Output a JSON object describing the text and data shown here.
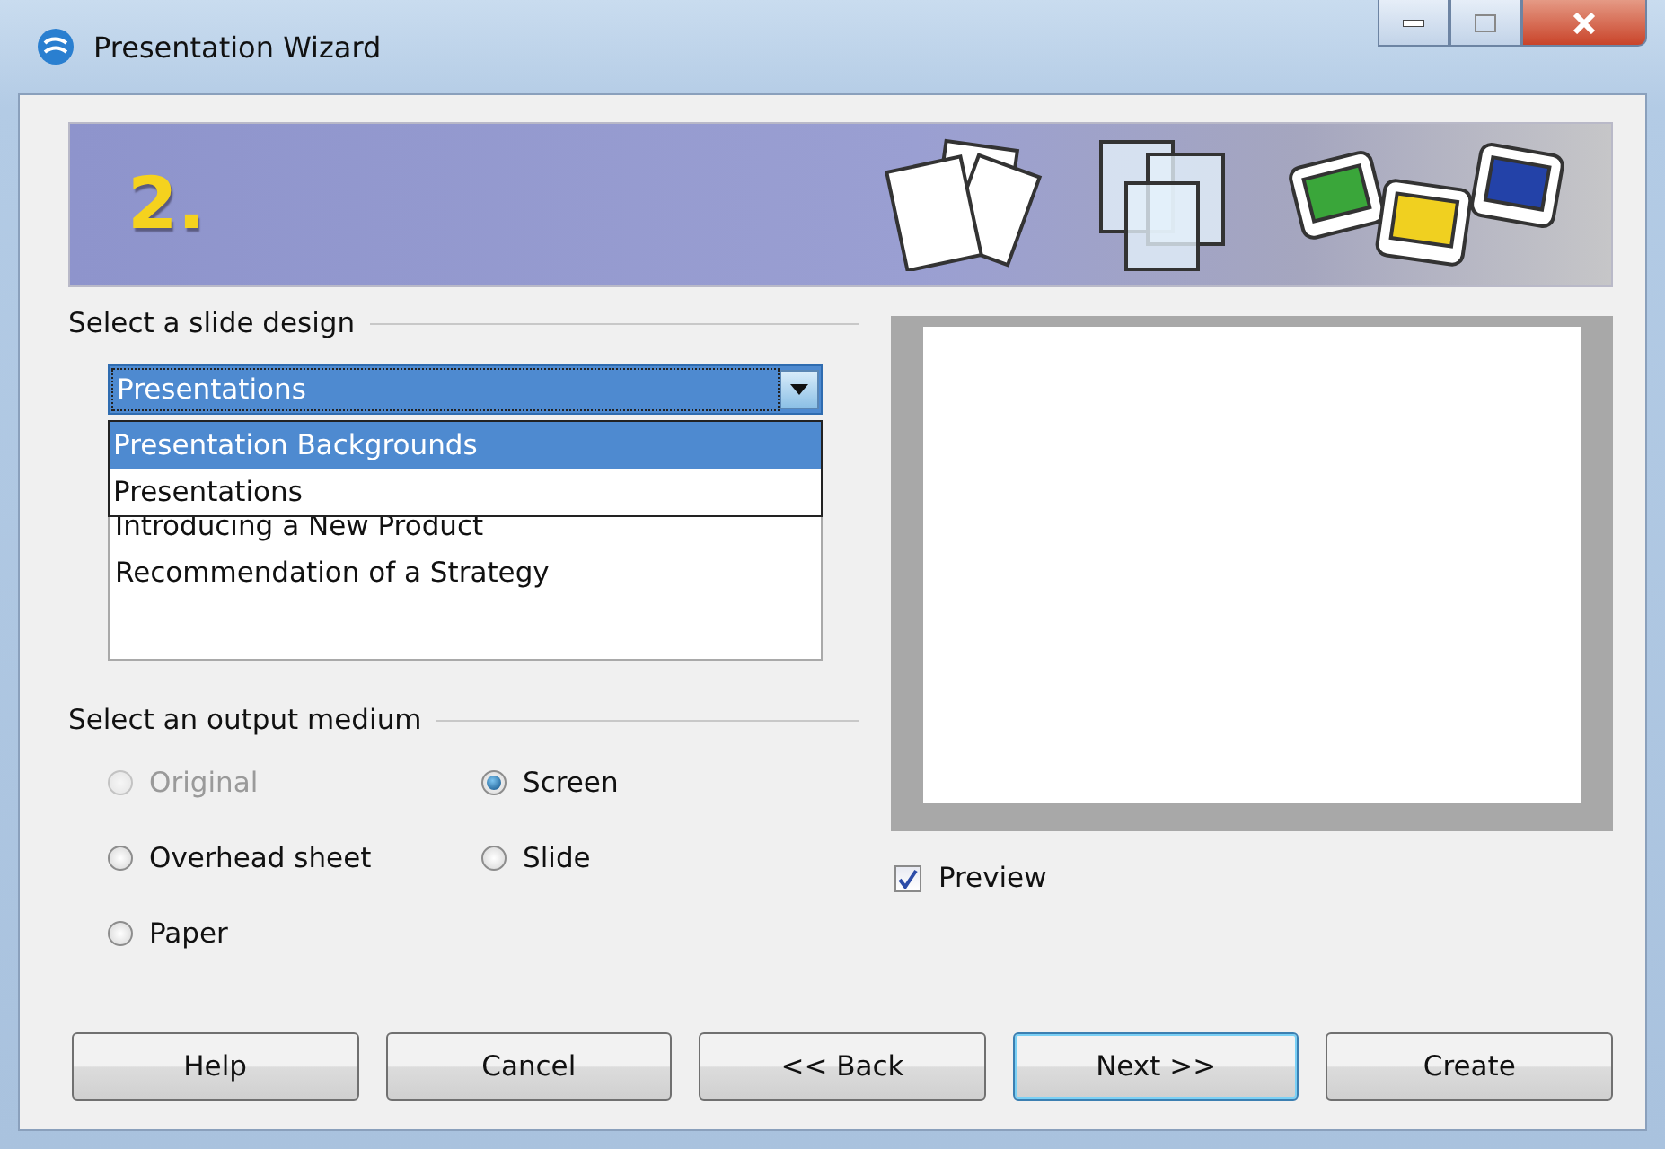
{
  "window": {
    "title": "Presentation Wizard"
  },
  "banner": {
    "step": "2."
  },
  "slide_design": {
    "label": "Select a slide design",
    "category": {
      "value": "Presentations",
      "expanded": true,
      "options": [
        {
          "label": "Presentation Backgrounds",
          "highlighted": true
        },
        {
          "label": "Presentations",
          "highlighted": false
        }
      ]
    },
    "designs": [
      "Introducing a New Product",
      "Recommendation of a Strategy"
    ]
  },
  "output_medium": {
    "label": "Select an output medium",
    "options": [
      {
        "label": "Original",
        "selected": false,
        "disabled": true
      },
      {
        "label": "Screen",
        "selected": true,
        "disabled": false
      },
      {
        "label": "Overhead sheet",
        "selected": false,
        "disabled": false
      },
      {
        "label": "Slide",
        "selected": false,
        "disabled": false
      },
      {
        "label": "Paper",
        "selected": false,
        "disabled": false
      }
    ]
  },
  "preview": {
    "label": "Preview",
    "checked": true
  },
  "buttons": [
    {
      "label": "Help",
      "focused": false
    },
    {
      "label": "Cancel",
      "focused": false
    },
    {
      "label": "<< Back",
      "focused": false
    },
    {
      "label": "Next >>",
      "focused": true
    },
    {
      "label": "Create",
      "focused": false
    }
  ]
}
